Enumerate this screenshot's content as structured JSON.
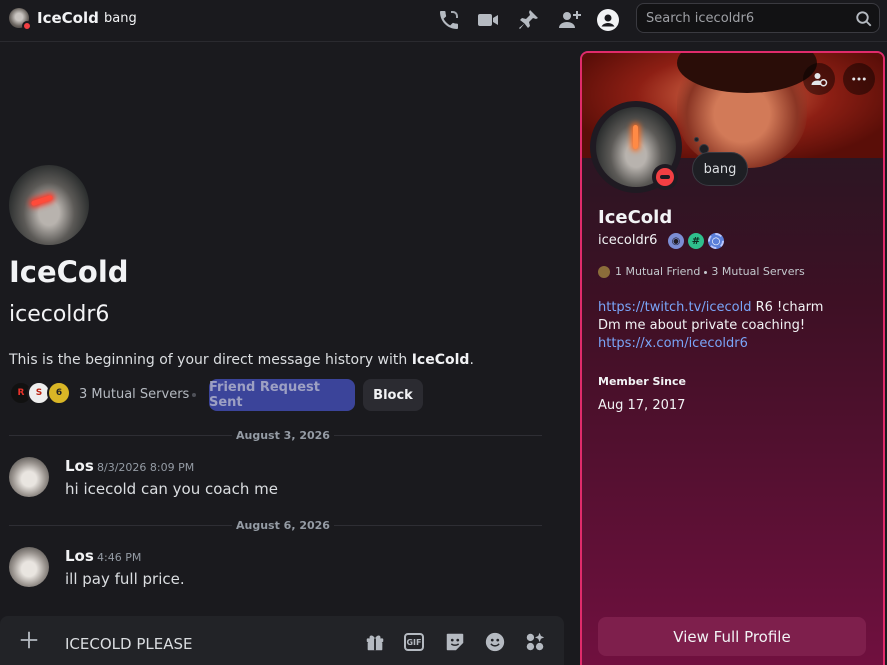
{
  "header": {
    "name": "IceCold",
    "tag": "bang",
    "search_placeholder": "Search icecoldr6",
    "icons": [
      "voice-call-icon",
      "video-call-icon",
      "pin-icon",
      "add-friend-icon",
      "user-profile-icon",
      "search-icon"
    ]
  },
  "intro": {
    "display_name": "IceCold",
    "username": "icecoldr6",
    "beginning_prefix": "This is the beginning of your direct message history with ",
    "beginning_name": "IceCold",
    "beginning_suffix": ".",
    "mutual_servers": "3 Mutual Servers",
    "server_icons": [
      "R",
      "S",
      "6"
    ],
    "friend_request_label": "Friend Request Sent",
    "block_label": "Block"
  },
  "messages": [
    {
      "date_divider": "August 3, 2026",
      "author": "Los",
      "timestamp": "8/3/2026 8:09 PM",
      "text": "hi icecold can you coach me"
    },
    {
      "date_divider": "August 6, 2026",
      "author": "Los",
      "timestamp": "4:46 PM",
      "text": "ill pay full price."
    }
  ],
  "composer": {
    "draft": "ICECOLD PLEASE",
    "icons": [
      "gift-icon",
      "gif-icon",
      "sticker-icon",
      "emoji-icon",
      "apps-icon"
    ],
    "gif_label": "GIF"
  },
  "profile": {
    "bubble_text": "bang",
    "display_name": "IceCold",
    "username": "icecoldr6",
    "badges": [
      "hypesquad-badge",
      "hashtag-badge",
      "nitro-badge"
    ],
    "mutual_friends": "1 Mutual Friend",
    "mutual_servers": "3 Mutual Servers",
    "bio_link1": "https://twitch.tv/icecold",
    "bio_line1_suffix": " R6 !charm",
    "bio_line2": "Dm me about private coaching!",
    "bio_link2": "https://x.com/icecoldr6",
    "member_since_label": "Member Since",
    "member_since_date": "Aug 17, 2017",
    "view_full_profile": "View Full Profile",
    "colors": {
      "border": "#e02b6b",
      "button": "#7e1f4c",
      "link": "#7aa5f8",
      "dnd": "#f23f43"
    }
  }
}
